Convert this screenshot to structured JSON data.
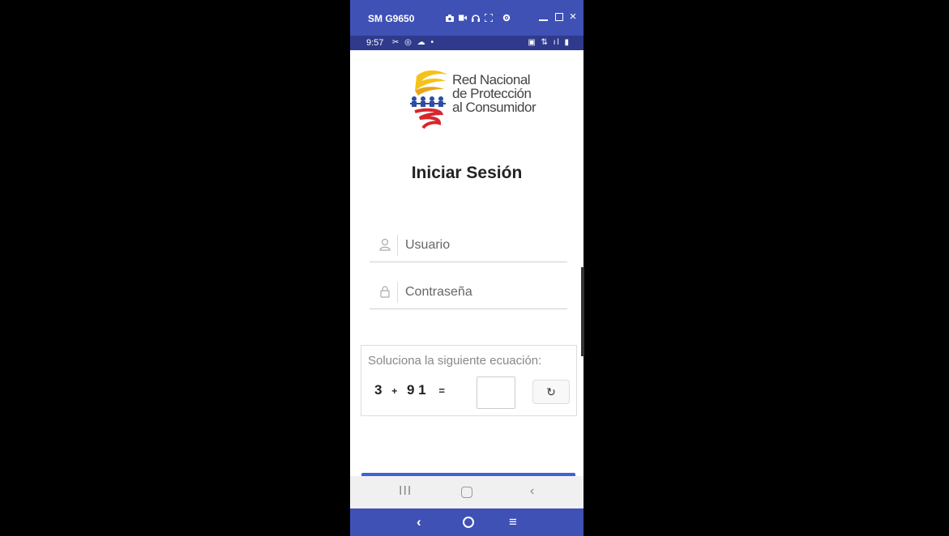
{
  "emulator": {
    "device_name": "SM G9650",
    "close_glyph": "×",
    "accent": "#3f51b5"
  },
  "status_bar": {
    "time": "9:57",
    "left_icons": "✂ ◎ ☁ •",
    "right_icons": "▣ ⇅ ıl ▮"
  },
  "logo": {
    "line1": "Red Nacional",
    "line2": "de Protección",
    "line3": "al Consumidor"
  },
  "login": {
    "title": "Iniciar Sesión",
    "username_placeholder": "Usuario",
    "password_placeholder": "Contraseña"
  },
  "captcha": {
    "label": "Soluciona la siguiente ecuación:",
    "operand1": "3",
    "operator": "+",
    "operand2": "9 1",
    "equals": "=",
    "refresh_glyph": "↻"
  },
  "android_nav": {
    "recent": "III",
    "back": "‹"
  },
  "emulator_nav": {
    "back": "‹",
    "menu": "≡"
  }
}
